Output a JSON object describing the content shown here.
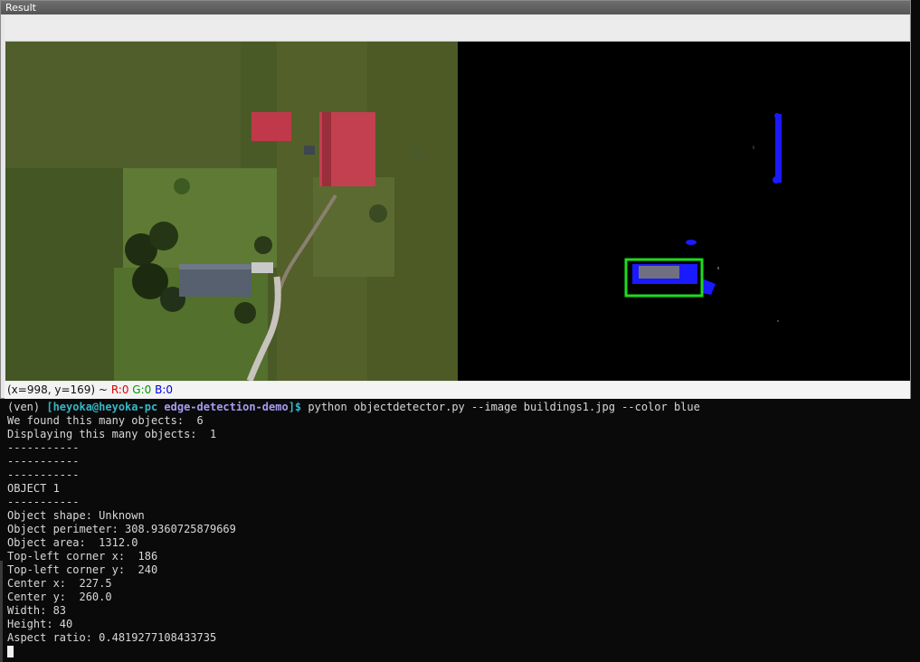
{
  "window": {
    "title": "Result",
    "status": {
      "coords": "(x=998, y=169) ~",
      "r": "R:0",
      "g": "G:0",
      "b": "B:0"
    }
  },
  "terminal": {
    "prompt": {
      "env": "(ven) ",
      "user_host": "[heyoka@heyoka-pc",
      "dir": " edge-detection-demo",
      "suffix": "]$ ",
      "command": "python objectdetector.py --image buildings1.jpg --color blue"
    },
    "lines": [
      "We found this many objects:  6",
      "Displaying this many objects:  1",
      "-----------",
      "-----------",
      "-----------",
      "OBJECT 1",
      "-----------",
      "Object shape: Unknown",
      "Object perimeter: 308.9360725879669",
      "Object area:  1312.0",
      "Top-left corner x:  186",
      "Top-left corner y:  240",
      "Center x:  227.5",
      "Center y:  260.0",
      "Width: 83",
      "Height: 40",
      "Aspect ratio: 0.4819277108433735"
    ]
  },
  "colors": {
    "field_grass": "#4c5b2a",
    "roof_red": "#c0394a",
    "detection_blue": "#1a1aff",
    "bbox_green": "#1cdc1c"
  }
}
